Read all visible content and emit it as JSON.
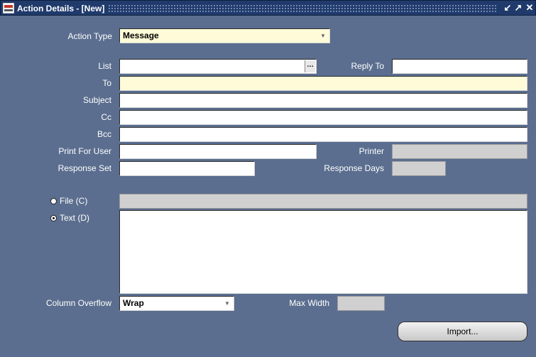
{
  "window": {
    "title": "Action Details - [New]"
  },
  "form": {
    "action_type_label": "Action Type",
    "action_type_value": "Message",
    "list_label": "List",
    "list_value": "",
    "reply_to_label": "Reply To",
    "reply_to_value": "",
    "to_label": "To",
    "to_value": "",
    "subject_label": "Subject",
    "subject_value": "",
    "cc_label": "Cc",
    "cc_value": "",
    "bcc_label": "Bcc",
    "bcc_value": "",
    "print_for_user_label": "Print For User",
    "print_for_user_value": "",
    "printer_label": "Printer",
    "printer_value": "",
    "response_set_label": "Response Set",
    "response_set_value": "",
    "response_days_label": "Response Days",
    "response_days_value": "",
    "file_radio_label": "File (C)",
    "file_value": "",
    "text_radio_label": "Text (D)",
    "text_selected": true,
    "column_overflow_label": "Column Overflow",
    "column_overflow_value": "Wrap",
    "max_width_label": "Max Width",
    "max_width_value": "",
    "import_button": "Import..."
  }
}
